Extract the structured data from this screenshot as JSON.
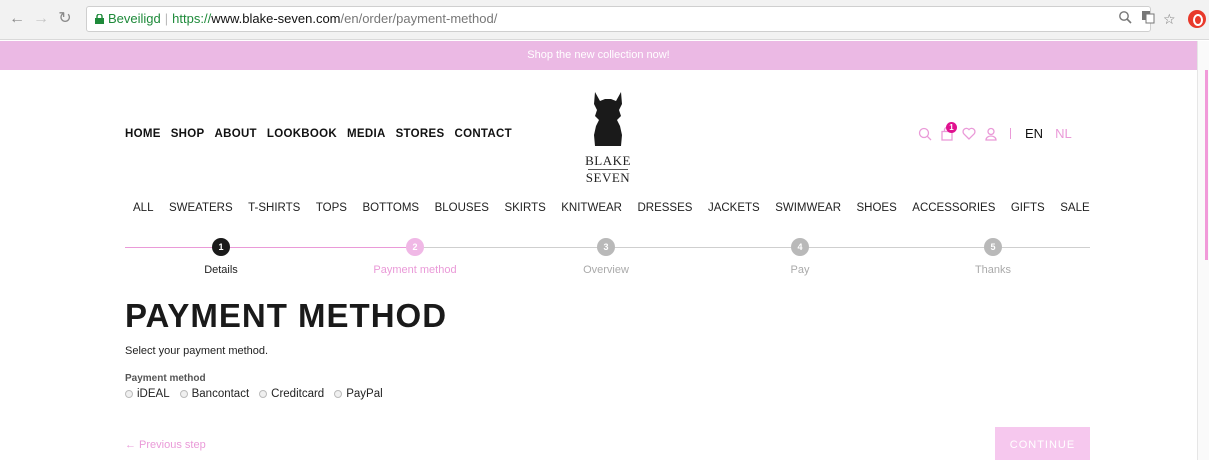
{
  "browser": {
    "secure_label": "Beveiligd",
    "url_scheme": "https://",
    "url_host": "www.blake-seven.com",
    "url_path": "/en/order/payment-method/"
  },
  "promo": {
    "text": "Shop the new collection now!"
  },
  "main_nav": [
    "HOME",
    "SHOP",
    "ABOUT",
    "LOOKBOOK",
    "MEDIA",
    "STORES",
    "CONTACT"
  ],
  "logo": {
    "line1": "BLAKE",
    "line2": "SEVEN"
  },
  "header": {
    "cart_count": "1",
    "lang_en": "EN",
    "lang_nl": "NL"
  },
  "categories": [
    "ALL",
    "SWEATERS",
    "T-SHIRTS",
    "TOPS",
    "BOTTOMS",
    "BLOUSES",
    "SKIRTS",
    "KNITWEAR",
    "DRESSES",
    "JACKETS",
    "SWIMWEAR",
    "SHOES",
    "ACCESSORIES",
    "GIFTS",
    "SALE"
  ],
  "steps": [
    {
      "number": "1",
      "label": "Details"
    },
    {
      "number": "2",
      "label": "Payment method"
    },
    {
      "number": "3",
      "label": "Overview"
    },
    {
      "number": "4",
      "label": "Pay"
    },
    {
      "number": "5",
      "label": "Thanks"
    }
  ],
  "content": {
    "title": "PAYMENT METHOD",
    "intro": "Select your payment method.",
    "payment_label": "Payment method",
    "options": [
      "iDEAL",
      "Bancontact",
      "Creditcard",
      "PayPal"
    ],
    "previous": "← Previous step",
    "continue": "CONTINUE"
  },
  "colors": {
    "brand_pink": "#ea9ad8",
    "promo_bg": "#ebb9e4",
    "active_step": "#1a1a1a",
    "inactive_step": "#b9b9b9",
    "badge": "#e0118f"
  }
}
